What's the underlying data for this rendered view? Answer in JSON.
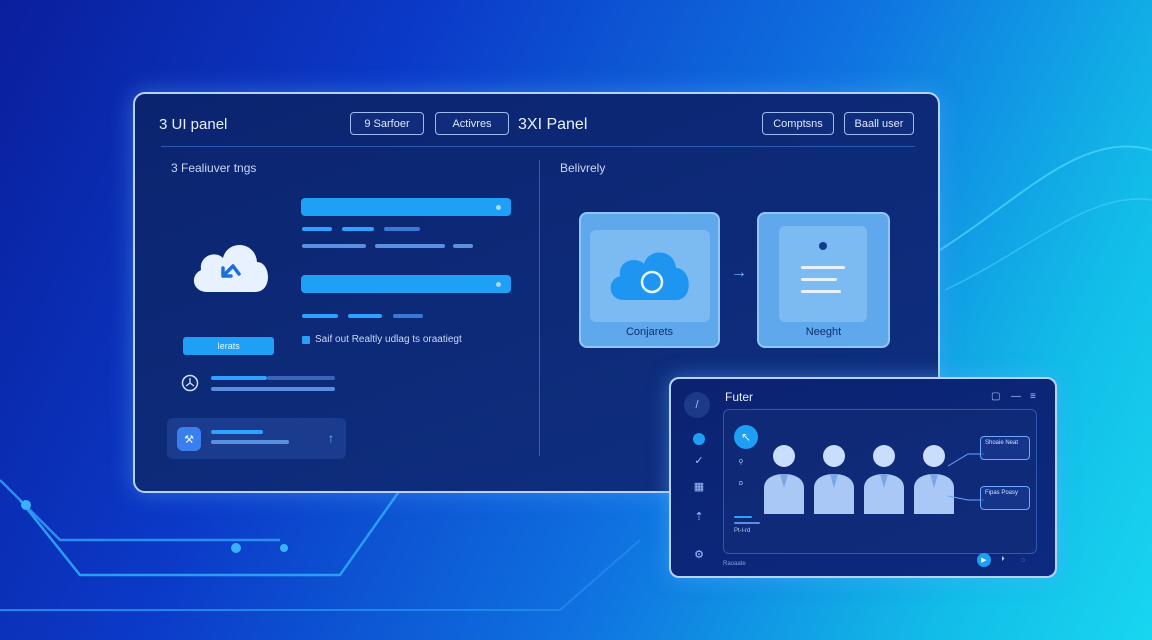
{
  "main_panel": {
    "title": "3 UI panel",
    "center_title": "3XI Panel",
    "header_buttons": [
      "9 Sarfoer",
      "Activres",
      "Comptsns",
      "Baall user"
    ],
    "left_section_label": "3 Fealiuver tngs",
    "right_section_label": "Belivrely",
    "teal_button_label": "Ierats",
    "checkbox_label": "Saif out Realtly udlag ts oraatiegt",
    "tiles": [
      {
        "label": "Conjarets",
        "icon": "cloud-icon"
      },
      {
        "label": "Neeght",
        "icon": "document-icon"
      }
    ],
    "arrow_icon": "arrow-right-icon"
  },
  "second_panel": {
    "title": "Futer",
    "top_controls": [
      "window-icon",
      "minimize-icon",
      "menu-icon"
    ],
    "sidebar_icons": [
      "compass-icon",
      "badge-icon",
      "check-icon",
      "calendar-icon",
      "upload-icon",
      "settings-icon"
    ],
    "callouts": [
      "Shoaie Neat",
      "Fipas Poasy"
    ],
    "caption": "Pt-l-rd",
    "footer_text": "Raoaate",
    "sub_icon_labels": [
      "ǫ",
      "ᴅ"
    ]
  },
  "colors": {
    "accent": "#1da0f5",
    "panel_bg": "#0d2a78",
    "border": "#b7d2ff",
    "tile_bg": "#5fa8ec"
  }
}
